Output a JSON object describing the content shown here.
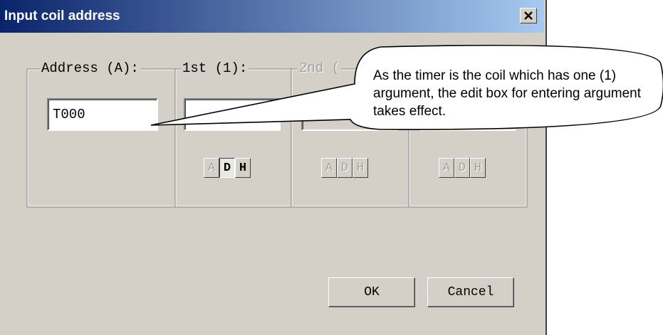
{
  "window": {
    "title": "Input coil address",
    "close_icon": "close-icon"
  },
  "groups": {
    "address": {
      "label": "Address (A):",
      "value": "T000"
    },
    "arg1": {
      "label": "1st (1):",
      "value": "",
      "modes": [
        "A",
        "D",
        "H"
      ]
    },
    "arg2": {
      "label": "2nd (",
      "modes": [
        "A",
        "D",
        "H"
      ]
    },
    "arg3": {
      "modes": [
        "A",
        "D",
        "H"
      ]
    }
  },
  "buttons": {
    "ok": "OK",
    "cancel": "Cancel"
  },
  "callout": {
    "text": "As the timer is the coil which has one (1) argument, the edit box for entering argument takes effect."
  }
}
